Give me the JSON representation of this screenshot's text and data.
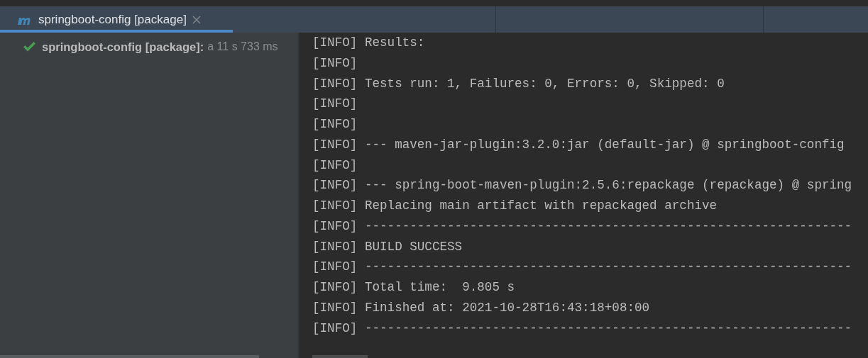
{
  "run_tab": {
    "label": "springboot-config [package]",
    "selected": true
  },
  "run_tree": {
    "items": [
      {
        "passed": true,
        "name": "springboot-config [package]:",
        "time": "a 11 s 733 ms"
      }
    ]
  },
  "console": {
    "lines": [
      "[INFO] Results:",
      "[INFO]",
      "[INFO] Tests run: 1, Failures: 0, Errors: 0, Skipped: 0",
      "[INFO]",
      "[INFO]",
      "[INFO] --- maven-jar-plugin:3.2.0:jar (default-jar) @ springboot-config",
      "[INFO]",
      "[INFO] --- spring-boot-maven-plugin:2.5.6:repackage (repackage) @ spring",
      "[INFO] Replacing main artifact with repackaged archive",
      "[INFO] -----------------------------------------------------------------",
      "[INFO] BUILD SUCCESS",
      "[INFO] -----------------------------------------------------------------",
      "[INFO] Total time:  9.805 s",
      "[INFO] Finished at: 2021-10-28T16:43:18+08:00",
      "[INFO] -----------------------------------------------------------------"
    ]
  }
}
